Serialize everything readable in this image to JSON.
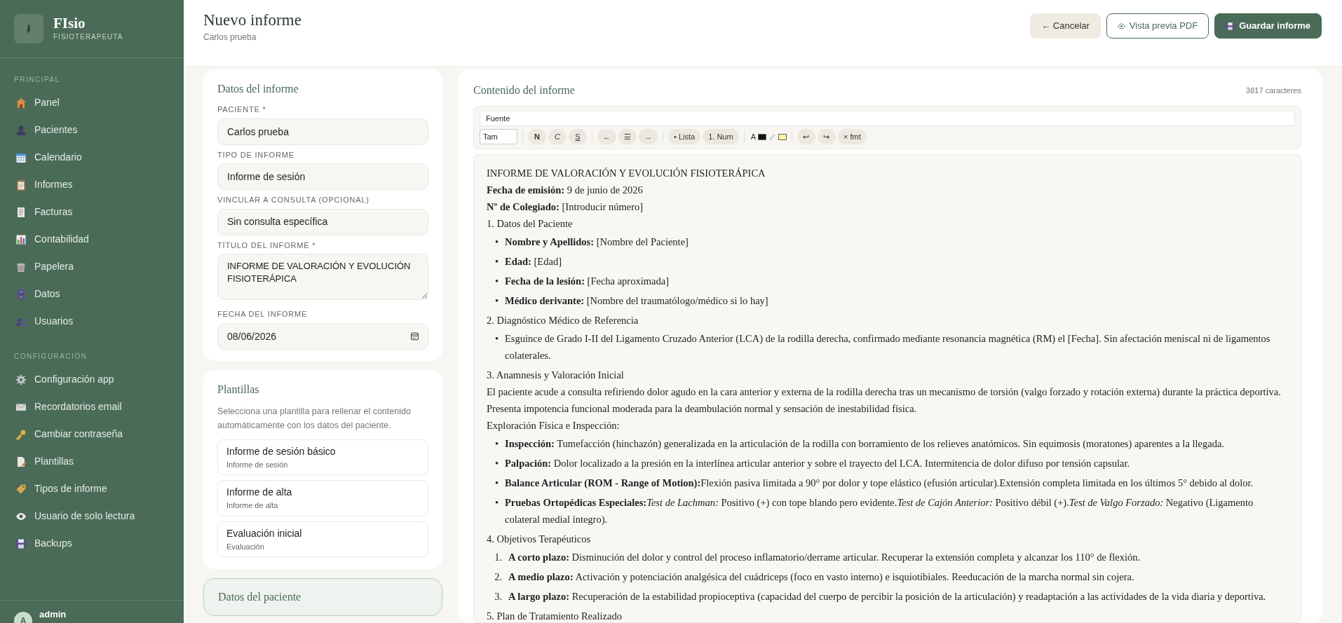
{
  "sidebar": {
    "brand": {
      "title": "FIsio",
      "subtitle": "FISIOTERAPEUTA"
    },
    "sections": [
      {
        "heading": "PRINCIPAL",
        "items": [
          {
            "label": "Panel",
            "selected": false
          },
          {
            "label": "Pacientes",
            "selected": false
          },
          {
            "label": "Calendario",
            "selected": false
          },
          {
            "label": "Informes",
            "selected": false
          },
          {
            "label": "Facturas",
            "selected": false
          },
          {
            "label": "Contabilidad",
            "selected": false
          },
          {
            "label": "Papelera",
            "selected": false
          },
          {
            "label": "Datos",
            "selected": false
          },
          {
            "label": "Usuarios",
            "selected": false
          }
        ]
      },
      {
        "heading": "CONFIGURACIÓN",
        "items": [
          {
            "label": "Configuración app",
            "selected": false
          },
          {
            "label": "Recordatorios email",
            "selected": false
          },
          {
            "label": "Cambiar contraseña",
            "selected": false
          },
          {
            "label": "Plantillas",
            "selected": false
          },
          {
            "label": "Tipos de informe",
            "selected": false
          },
          {
            "label": "Usuario de solo lectura",
            "selected": false
          },
          {
            "label": "Backups",
            "selected": false
          }
        ]
      }
    ],
    "user": {
      "initial": "A",
      "name": "admin"
    }
  },
  "header": {
    "title": "Nuevo informe",
    "subtitle": "Carlos prueba",
    "buttons": [
      {
        "label": "← Cancelar",
        "kind": "secondary"
      },
      {
        "label": "Vista previa PDF",
        "kind": "outline"
      },
      {
        "label": "Guardar informe",
        "kind": "primary"
      }
    ]
  },
  "report_form": {
    "title": "Datos del informe",
    "fields": [
      {
        "label": "PACIENTE *",
        "kind": "text",
        "value": "Carlos prueba"
      },
      {
        "label": "TIPO DE INFORME",
        "kind": "select",
        "value": "Informe de sesión"
      },
      {
        "label": "VINCULAR A CONSULTA (OPCIONAL)",
        "kind": "select",
        "value": "Sin consulta específica"
      },
      {
        "label": "TÍTULO DEL INFORME *",
        "kind": "textarea",
        "value": "INFORME DE VALORACIÓN Y EVOLUCIÓN FISIOTERÁPICA"
      },
      {
        "label": "FECHA DEL INFORME",
        "kind": "date",
        "value": "08/06/2026"
      }
    ]
  },
  "templates": {
    "title": "Plantillas",
    "description": "Selecciona una plantilla para rellenar el contenido automáticamente con los datos del paciente.",
    "items": [
      {
        "name": "Informe de sesión básico",
        "type": "Informe de sesión"
      },
      {
        "name": "Informe de alta",
        "type": "Informe de alta"
      },
      {
        "name": "Evaluación inicial",
        "type": "Evaluación"
      }
    ]
  },
  "patient_card": {
    "title": "Datos del paciente"
  },
  "content": {
    "title": "Contenido del informe",
    "count": "3817 caracteres",
    "font_select": "Fuente",
    "size_select": "Tam",
    "toolbar": [
      [
        {
          "kind": "button",
          "label": "N"
        },
        {
          "kind": "button",
          "label": "C"
        },
        {
          "kind": "button",
          "label": "S"
        }
      ],
      [
        {
          "kind": "button",
          "label": "←"
        },
        {
          "kind": "button",
          "label": "☰"
        },
        {
          "kind": "button",
          "label": "→"
        }
      ],
      [
        {
          "kind": "button",
          "label": "• Lista"
        },
        {
          "kind": "button",
          "label": "1. Num"
        }
      ],
      [
        {
          "kind": "text",
          "label": "A"
        },
        {
          "kind": "swatch",
          "color": "#111111"
        },
        {
          "kind": "pencil"
        },
        {
          "kind": "swatch",
          "color": "#fff59d"
        }
      ],
      [
        {
          "kind": "button",
          "label": "↩"
        },
        {
          "kind": "button",
          "label": "↪"
        },
        {
          "kind": "button",
          "label": "× fmt"
        }
      ]
    ],
    "blocks": [
      {
        "kind": "para",
        "text": "INFORME DE VALORACIÓN Y EVOLUCIÓN FISIOTERÁPICA"
      },
      {
        "kind": "para",
        "text": "**Fecha de emisión:** 9 de junio de 2026"
      },
      {
        "kind": "para",
        "text": "**Nº de Colegiado:** [Introducir número]"
      },
      {
        "kind": "para",
        "text": "1. Datos del Paciente"
      },
      {
        "kind": "bullets",
        "items": [
          {
            "marker": "•",
            "text": "**Nombre y Apellidos:** [Nombre del Paciente]"
          },
          {
            "marker": "•",
            "text": "**Edad:** [Edad]"
          },
          {
            "marker": "•",
            "text": "**Fecha de la lesión:** [Fecha aproximada]"
          },
          {
            "marker": "•",
            "text": "**Médico derivante:** [Nombre del traumatólogo/médico si lo hay]"
          }
        ]
      },
      {
        "kind": "para",
        "text": "2. Diagnóstico Médico de Referencia"
      },
      {
        "kind": "bullets",
        "items": [
          {
            "marker": "•",
            "text": "Esguince de Grado I-II del Ligamento Cruzado Anterior (LCA) de la rodilla derecha, confirmado mediante resonancia magnética (RM) el [Fecha]. Sin afectación meniscal ni de ligamentos colaterales."
          }
        ]
      },
      {
        "kind": "para",
        "text": "3. Anamnesis y Valoración Inicial"
      },
      {
        "kind": "para",
        "text": "El paciente acude a consulta refiriendo dolor agudo en la cara anterior y externa de la rodilla derecha tras un mecanismo de torsión (valgo forzado y rotación externa) durante la práctica deportiva. Presenta impotencia funcional moderada para la deambulación normal y sensación de inestabilidad física."
      },
      {
        "kind": "para",
        "text": "Exploración Física e Inspección:"
      },
      {
        "kind": "bullets",
        "items": [
          {
            "marker": "•",
            "text": "**Inspección:** Tumefacción (hinchazón) generalizada en la articulación de la rodilla con borramiento de los relieves anatómicos. Sin equimosis (moratones) aparentes a la llegada."
          },
          {
            "marker": "•",
            "text": "**Palpación:** Dolor localizado a la presión en la interlínea articular anterior y sobre el trayecto del LCA. Intermitencia de dolor difuso por tensión capsular."
          },
          {
            "marker": "•",
            "text": "**Balance Articular (ROM - Range of Motion):**Flexión pasiva limitada a 90° por dolor y tope elástico (efusión articular).Extensión completa limitada en los últimos 5° debido al dolor."
          },
          {
            "marker": "•",
            "text": [
              "**Pruebas Ortopédicas Especiales:**",
              "*Test de Lachman:* Positivo (+) con tope blando pero evidente.*Test de Cajón Anterior:* Positivo débil (+).*Test de Valgo Forzado:* Negativo (Ligamento colateral medial íntegro)."
            ]
          }
        ]
      },
      {
        "kind": "para",
        "text": "4. Objetivos Terapéuticos"
      },
      {
        "kind": "numbered",
        "items": [
          {
            "marker": "1.",
            "text": "**A corto plazo:** Disminución del dolor y control del proceso inflamatorio/derrame articular. Recuperar la extensión completa y alcanzar los 110° de flexión."
          },
          {
            "marker": "2.",
            "text": "**A medio plazo:** Activación y potenciación analgésica del cuádriceps (foco en vasto interno) e isquiotibiales. Reeducación de la marcha normal sin cojera."
          },
          {
            "marker": "3.",
            "text": "**A largo plazo:** Recuperación de la estabilidad propioceptiva (capacidad del cuerpo de percibir la posición de la articulación) y readaptación a las actividades de la vida diaria y deportiva."
          }
        ]
      },
      {
        "kind": "para",
        "text": "5. Plan de Tratamiento Realizado"
      }
    ]
  }
}
